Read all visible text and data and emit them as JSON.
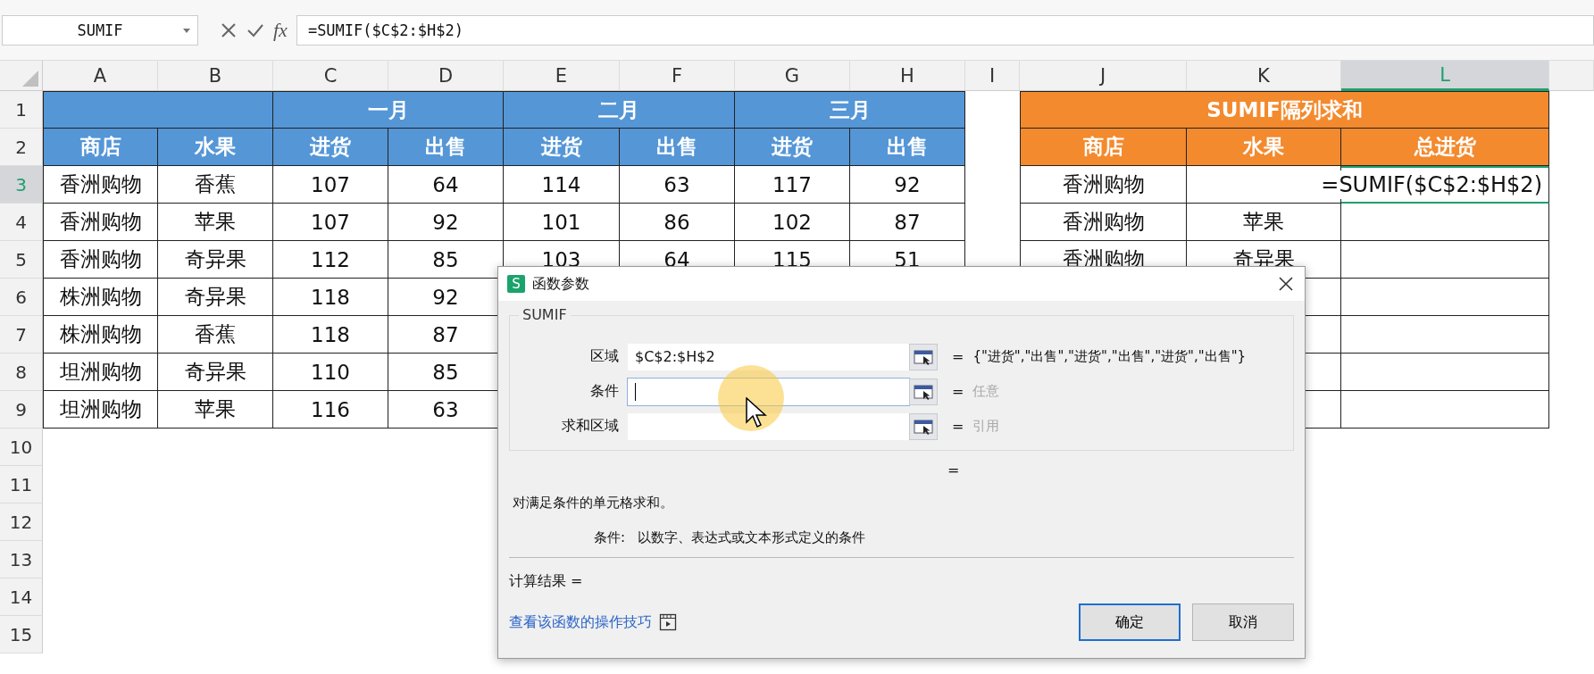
{
  "formula_bar": {
    "name_box": "SUMIF",
    "fx_label": "fx",
    "formula": "=SUMIF($C$2:$H$2)"
  },
  "columns": [
    {
      "label": "A",
      "selected": false
    },
    {
      "label": "B",
      "selected": false
    },
    {
      "label": "C",
      "selected": false
    },
    {
      "label": "D",
      "selected": false
    },
    {
      "label": "E",
      "selected": false
    },
    {
      "label": "F",
      "selected": false
    },
    {
      "label": "G",
      "selected": false
    },
    {
      "label": "H",
      "selected": false
    },
    {
      "label": "I",
      "selected": false
    },
    {
      "label": "J",
      "selected": false
    },
    {
      "label": "K",
      "selected": false
    },
    {
      "label": "L",
      "selected": true
    }
  ],
  "row_numbers": [
    {
      "label": "1",
      "selected": false
    },
    {
      "label": "2",
      "selected": false
    },
    {
      "label": "3",
      "selected": true
    },
    {
      "label": "4",
      "selected": false
    },
    {
      "label": "5",
      "selected": false
    },
    {
      "label": "6",
      "selected": false
    },
    {
      "label": "7",
      "selected": false
    },
    {
      "label": "8",
      "selected": false
    },
    {
      "label": "9",
      "selected": false
    },
    {
      "label": "10",
      "selected": false
    },
    {
      "label": "11",
      "selected": false
    },
    {
      "label": "12",
      "selected": false
    },
    {
      "label": "13",
      "selected": false
    },
    {
      "label": "14",
      "selected": false
    },
    {
      "label": "15",
      "selected": false
    }
  ],
  "main_table": {
    "months": [
      "一月",
      "二月",
      "三月"
    ],
    "headers": [
      "商店",
      "水果",
      "进货",
      "出售",
      "进货",
      "出售",
      "进货",
      "出售"
    ],
    "rows": [
      {
        "store": "香洲购物",
        "fruit": "香蕉",
        "values": [
          "107",
          "64",
          "114",
          "63",
          "117",
          "92"
        ]
      },
      {
        "store": "香洲购物",
        "fruit": "苹果",
        "values": [
          "107",
          "92",
          "101",
          "86",
          "102",
          "87"
        ]
      },
      {
        "store": "香洲购物",
        "fruit": "奇异果",
        "values": [
          "112",
          "85",
          "103",
          "64",
          "115",
          "51"
        ]
      },
      {
        "store": "株洲购物",
        "fruit": "奇异果",
        "values": [
          "118",
          "92"
        ]
      },
      {
        "store": "株洲购物",
        "fruit": "香蕉",
        "values": [
          "118",
          "87"
        ]
      },
      {
        "store": "坦洲购物",
        "fruit": "奇异果",
        "values": [
          "110",
          "85"
        ]
      },
      {
        "store": "坦洲购物",
        "fruit": "苹果",
        "values": [
          "116",
          "63"
        ]
      }
    ]
  },
  "summary_table": {
    "title": "SUMIF隔列求和",
    "headers": [
      "商店",
      "水果",
      "总进货"
    ],
    "rows": [
      {
        "store": "香洲购物",
        "total": "=SUMIF($C$2:$H$2)",
        "editing": true
      },
      {
        "store": "香洲购物",
        "fruit": "苹果",
        "editing": false
      },
      {
        "store": "香洲购物",
        "fruit": "奇异果",
        "editing": false
      }
    ]
  },
  "dialog": {
    "icon_letter": "S",
    "title": "函数参数",
    "function_name": "SUMIF",
    "args": [
      {
        "label": "区域",
        "value": "$C$2:$H$2",
        "sign": "=",
        "result": "{\"进货\",\"出售\",\"进货\",\"出售\",\"进货\",\"出售\"}",
        "result_dimmed": false,
        "focused": false
      },
      {
        "label": "条件",
        "sign": "=",
        "result": "任意",
        "result_dimmed": true,
        "focused": true
      },
      {
        "label": "求和区域",
        "sign": "=",
        "result": "引用",
        "result_dimmed": true,
        "focused": false
      }
    ],
    "formula_sign": "=",
    "description": "对满足条件的单元格求和。",
    "arg_help_label": "条件:",
    "arg_help_text": "以数字、表达式或文本形式定义的条件",
    "result_label": "计算结果 =",
    "help_link": "查看该函数的操作技巧",
    "buttons": [
      {
        "label": "确定",
        "default": true
      },
      {
        "label": "取消",
        "default": false
      }
    ]
  }
}
